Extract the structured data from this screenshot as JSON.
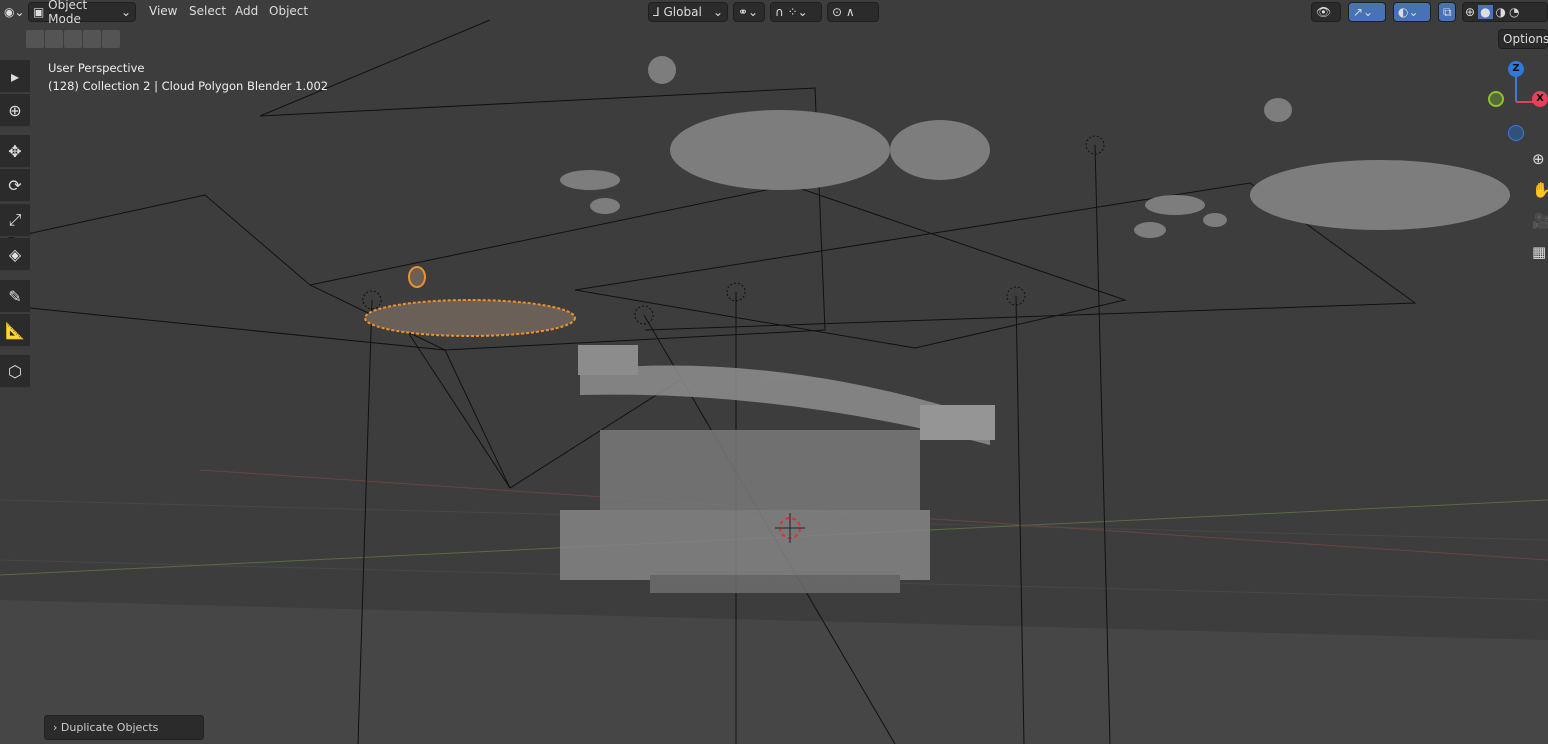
{
  "header": {
    "editor_type_icon": "viewport-icon",
    "mode": "Object Mode",
    "menus": [
      "View",
      "Select",
      "Add",
      "Object"
    ],
    "transform_orientation": "Global",
    "options_button": "Options"
  },
  "viewport": {
    "view_name": "User Perspective",
    "info": "(128) Collection 2 | Cloud Polygon Blender 1.002"
  },
  "toolbar": [
    "select-box",
    "cursor",
    "move",
    "rotate",
    "scale",
    "transform",
    "annotate",
    "measure",
    "add-cube"
  ],
  "gizmo": {
    "z": "Z",
    "x": "X"
  },
  "operator_panel": "Duplicate Objects",
  "colors": {
    "accent": "#4772b3",
    "selection": "#f0902a",
    "bg": "#3d3d3d"
  }
}
